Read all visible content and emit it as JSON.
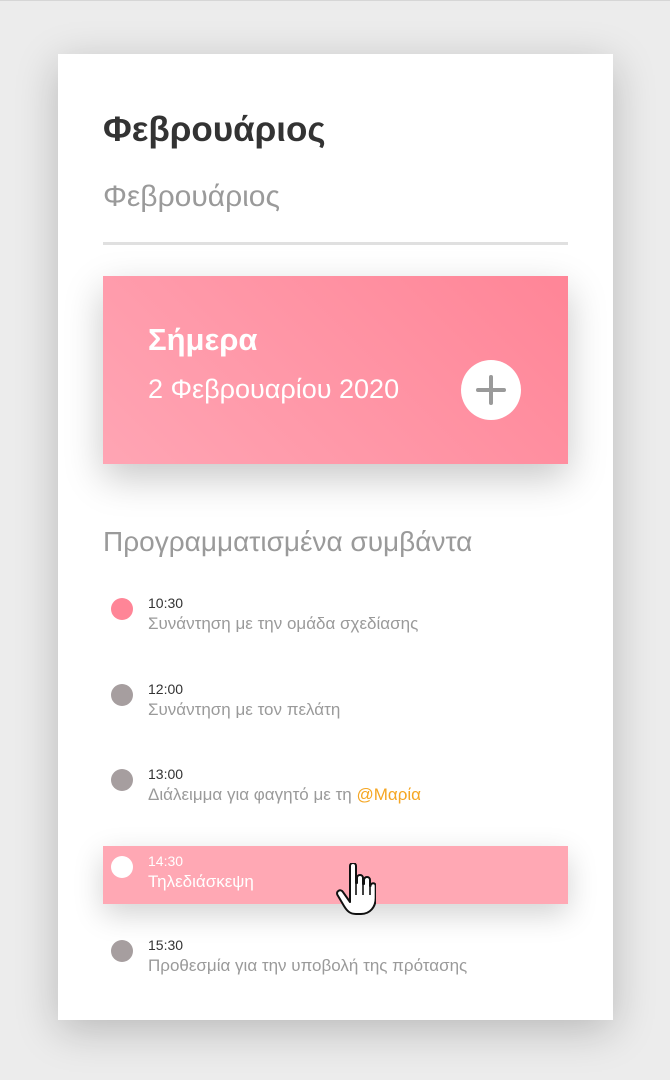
{
  "header": {
    "month_title": "Φεβρουάριος",
    "month_subtitle": "Φεβρουάριος"
  },
  "today": {
    "label": "Σήμερα",
    "date": "2 Φεβρουαρίου 2020",
    "add_icon": "plus-icon"
  },
  "events": {
    "heading": "Προγραμματισμένα συμβάντα",
    "items": [
      {
        "time": "10:30",
        "text": "Συνάντηση με την ομάδα σχεδίασης",
        "mention": ""
      },
      {
        "time": "12:00",
        "text": "Συνάντηση με τον πελάτη",
        "mention": ""
      },
      {
        "time": "13:00",
        "text": "Διάλειμμα για φαγητό με τη ",
        "mention": "@Μαρία"
      },
      {
        "time": "14:30",
        "text": "Τηλεδιάσκεψη",
        "mention": ""
      },
      {
        "time": "15:30",
        "text": "Προθεσμία για την υποβολή της πρότασης",
        "mention": ""
      }
    ]
  },
  "colors": {
    "accent_pink": "#ff8597",
    "highlight_pink": "#ffa8b4",
    "mention_orange": "#f5a623",
    "inactive_dot": "#a69e9f"
  },
  "cursor": {
    "icon": "hand-pointer-icon"
  }
}
